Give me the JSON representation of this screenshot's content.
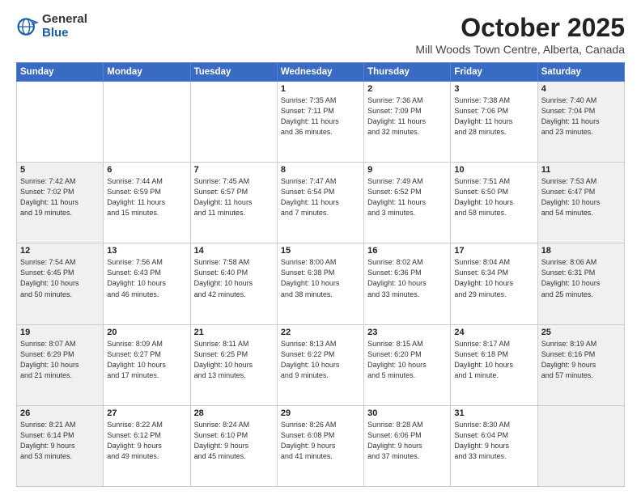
{
  "logo": {
    "general": "General",
    "blue": "Blue"
  },
  "header": {
    "month": "October 2025",
    "location": "Mill Woods Town Centre, Alberta, Canada"
  },
  "weekdays": [
    "Sunday",
    "Monday",
    "Tuesday",
    "Wednesday",
    "Thursday",
    "Friday",
    "Saturday"
  ],
  "weeks": [
    [
      {
        "day": "",
        "info": "",
        "shaded": false
      },
      {
        "day": "",
        "info": "",
        "shaded": false
      },
      {
        "day": "",
        "info": "",
        "shaded": false
      },
      {
        "day": "1",
        "info": "Sunrise: 7:35 AM\nSunset: 7:11 PM\nDaylight: 11 hours\nand 36 minutes.",
        "shaded": false
      },
      {
        "day": "2",
        "info": "Sunrise: 7:36 AM\nSunset: 7:09 PM\nDaylight: 11 hours\nand 32 minutes.",
        "shaded": false
      },
      {
        "day": "3",
        "info": "Sunrise: 7:38 AM\nSunset: 7:06 PM\nDaylight: 11 hours\nand 28 minutes.",
        "shaded": false
      },
      {
        "day": "4",
        "info": "Sunrise: 7:40 AM\nSunset: 7:04 PM\nDaylight: 11 hours\nand 23 minutes.",
        "shaded": true
      }
    ],
    [
      {
        "day": "5",
        "info": "Sunrise: 7:42 AM\nSunset: 7:02 PM\nDaylight: 11 hours\nand 19 minutes.",
        "shaded": true
      },
      {
        "day": "6",
        "info": "Sunrise: 7:44 AM\nSunset: 6:59 PM\nDaylight: 11 hours\nand 15 minutes.",
        "shaded": false
      },
      {
        "day": "7",
        "info": "Sunrise: 7:45 AM\nSunset: 6:57 PM\nDaylight: 11 hours\nand 11 minutes.",
        "shaded": false
      },
      {
        "day": "8",
        "info": "Sunrise: 7:47 AM\nSunset: 6:54 PM\nDaylight: 11 hours\nand 7 minutes.",
        "shaded": false
      },
      {
        "day": "9",
        "info": "Sunrise: 7:49 AM\nSunset: 6:52 PM\nDaylight: 11 hours\nand 3 minutes.",
        "shaded": false
      },
      {
        "day": "10",
        "info": "Sunrise: 7:51 AM\nSunset: 6:50 PM\nDaylight: 10 hours\nand 58 minutes.",
        "shaded": false
      },
      {
        "day": "11",
        "info": "Sunrise: 7:53 AM\nSunset: 6:47 PM\nDaylight: 10 hours\nand 54 minutes.",
        "shaded": true
      }
    ],
    [
      {
        "day": "12",
        "info": "Sunrise: 7:54 AM\nSunset: 6:45 PM\nDaylight: 10 hours\nand 50 minutes.",
        "shaded": true
      },
      {
        "day": "13",
        "info": "Sunrise: 7:56 AM\nSunset: 6:43 PM\nDaylight: 10 hours\nand 46 minutes.",
        "shaded": false
      },
      {
        "day": "14",
        "info": "Sunrise: 7:58 AM\nSunset: 6:40 PM\nDaylight: 10 hours\nand 42 minutes.",
        "shaded": false
      },
      {
        "day": "15",
        "info": "Sunrise: 8:00 AM\nSunset: 6:38 PM\nDaylight: 10 hours\nand 38 minutes.",
        "shaded": false
      },
      {
        "day": "16",
        "info": "Sunrise: 8:02 AM\nSunset: 6:36 PM\nDaylight: 10 hours\nand 33 minutes.",
        "shaded": false
      },
      {
        "day": "17",
        "info": "Sunrise: 8:04 AM\nSunset: 6:34 PM\nDaylight: 10 hours\nand 29 minutes.",
        "shaded": false
      },
      {
        "day": "18",
        "info": "Sunrise: 8:06 AM\nSunset: 6:31 PM\nDaylight: 10 hours\nand 25 minutes.",
        "shaded": true
      }
    ],
    [
      {
        "day": "19",
        "info": "Sunrise: 8:07 AM\nSunset: 6:29 PM\nDaylight: 10 hours\nand 21 minutes.",
        "shaded": true
      },
      {
        "day": "20",
        "info": "Sunrise: 8:09 AM\nSunset: 6:27 PM\nDaylight: 10 hours\nand 17 minutes.",
        "shaded": false
      },
      {
        "day": "21",
        "info": "Sunrise: 8:11 AM\nSunset: 6:25 PM\nDaylight: 10 hours\nand 13 minutes.",
        "shaded": false
      },
      {
        "day": "22",
        "info": "Sunrise: 8:13 AM\nSunset: 6:22 PM\nDaylight: 10 hours\nand 9 minutes.",
        "shaded": false
      },
      {
        "day": "23",
        "info": "Sunrise: 8:15 AM\nSunset: 6:20 PM\nDaylight: 10 hours\nand 5 minutes.",
        "shaded": false
      },
      {
        "day": "24",
        "info": "Sunrise: 8:17 AM\nSunset: 6:18 PM\nDaylight: 10 hours\nand 1 minute.",
        "shaded": false
      },
      {
        "day": "25",
        "info": "Sunrise: 8:19 AM\nSunset: 6:16 PM\nDaylight: 9 hours\nand 57 minutes.",
        "shaded": true
      }
    ],
    [
      {
        "day": "26",
        "info": "Sunrise: 8:21 AM\nSunset: 6:14 PM\nDaylight: 9 hours\nand 53 minutes.",
        "shaded": true
      },
      {
        "day": "27",
        "info": "Sunrise: 8:22 AM\nSunset: 6:12 PM\nDaylight: 9 hours\nand 49 minutes.",
        "shaded": false
      },
      {
        "day": "28",
        "info": "Sunrise: 8:24 AM\nSunset: 6:10 PM\nDaylight: 9 hours\nand 45 minutes.",
        "shaded": false
      },
      {
        "day": "29",
        "info": "Sunrise: 8:26 AM\nSunset: 6:08 PM\nDaylight: 9 hours\nand 41 minutes.",
        "shaded": false
      },
      {
        "day": "30",
        "info": "Sunrise: 8:28 AM\nSunset: 6:06 PM\nDaylight: 9 hours\nand 37 minutes.",
        "shaded": false
      },
      {
        "day": "31",
        "info": "Sunrise: 8:30 AM\nSunset: 6:04 PM\nDaylight: 9 hours\nand 33 minutes.",
        "shaded": false
      },
      {
        "day": "",
        "info": "",
        "shaded": true
      }
    ]
  ]
}
